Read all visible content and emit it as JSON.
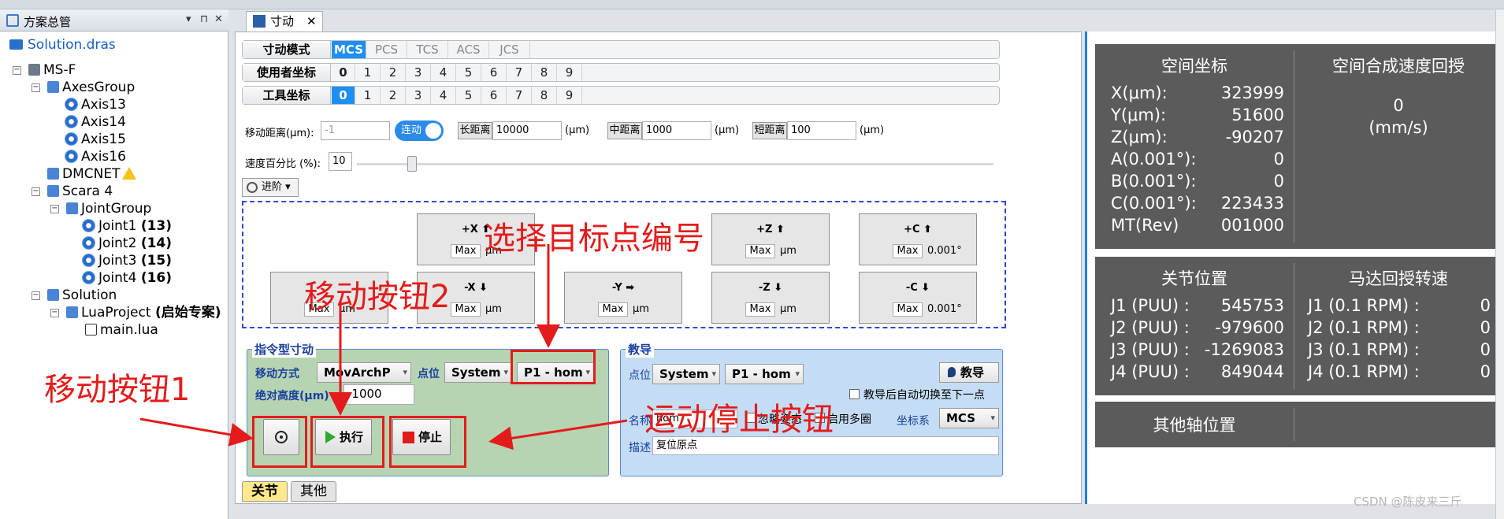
{
  "left_panel": {
    "title": "方案总管",
    "header_buttons": [
      "▾",
      "⊓",
      "✕"
    ],
    "tree": [
      {
        "label": "Solution.dras",
        "bold": ""
      },
      {
        "label": "MS-F",
        "bold": ""
      },
      {
        "label": "AxesGroup",
        "bold": ""
      },
      {
        "label": "Axis13",
        "bold": ""
      },
      {
        "label": "Axis14",
        "bold": ""
      },
      {
        "label": "Axis15",
        "bold": ""
      },
      {
        "label": "Axis16",
        "bold": ""
      },
      {
        "label": "DMCNET",
        "bold": ""
      },
      {
        "label": "Scara 4",
        "bold": ""
      },
      {
        "label": "JointGroup",
        "bold": ""
      },
      {
        "label": "Joint1 ",
        "bold": "(13)"
      },
      {
        "label": "Joint2 ",
        "bold": "(14)"
      },
      {
        "label": "Joint3 ",
        "bold": "(15)"
      },
      {
        "label": "Joint4 ",
        "bold": "(16)"
      },
      {
        "label": "Solution",
        "bold": ""
      },
      {
        "label": "LuaProject ",
        "bold": "(启始专案)"
      },
      {
        "label": "main.lua",
        "bold": ""
      }
    ]
  },
  "doc_tab": {
    "label": "寸动",
    "close": "✕"
  },
  "modes": {
    "jog_mode_label": "寸动模式",
    "jog_modes": [
      "MCS",
      "PCS",
      "TCS",
      "ACS",
      "JCS"
    ],
    "user_coord_label": "使用者坐标",
    "tool_coord_label": "工具坐标",
    "indices": [
      "0",
      "1",
      "2",
      "3",
      "4",
      "5",
      "6",
      "7",
      "8",
      "9"
    ]
  },
  "distance": {
    "label": "移动距离(μm):",
    "value": "-1",
    "toggle": "连动",
    "long_label": "长距离",
    "long_value": "10000",
    "mid_label": "中距离",
    "mid_value": "1000",
    "short_label": "短距离",
    "short_value": "100",
    "unit": "(μm)"
  },
  "speed": {
    "label": "速度百分比 (%):",
    "value": "10",
    "fraction": 0.08
  },
  "advanced_label": "进阶",
  "jog_buttons": {
    "px": "+X",
    "pz": "+Z",
    "pc": "+C",
    "nx": "-X",
    "ny": "-Y",
    "nz": "-Z",
    "nc": "-C",
    "max": "Max",
    "um": "μm",
    "deg": "0.001°"
  },
  "command_jog": {
    "title": "指令型寸动",
    "move_mode_label": "移动方式",
    "move_mode_value": "MovArchP",
    "point_label": "点位",
    "point_system": "System",
    "point_value": "P1 - hom",
    "abs_height_label": "绝对高度(μm)",
    "abs_height_value": "-1000",
    "exec_label": "执行",
    "stop_label": "停止"
  },
  "teach": {
    "title": "教导",
    "point_label": "点位",
    "system": "System",
    "point_value": "P1 - hom",
    "teach_button": "教导",
    "auto_switch": "教导后自动切换至下一点",
    "name_label": "名称",
    "name_value": "hom",
    "ignore_pose": "忽略姿态",
    "multi_turn": "启用多圈",
    "coord_label": "坐标系",
    "coord_value": "MCS",
    "desc_label": "描述",
    "desc_value": "复位原点"
  },
  "bottom_tabs": [
    "关节",
    "其他"
  ],
  "annotations": {
    "select_target": "选择目标点编号",
    "move_btn2": "移动按钮2",
    "move_btn1": "移动按钮1",
    "stop_btn": "运动停止按钮"
  },
  "space_coords": {
    "title": "空间坐标",
    "speed_title": "空间合成速度回授",
    "speed_value": "0",
    "speed_unit": "(mm/s)",
    "rows": [
      {
        "label": "X(μm):",
        "value": "323999"
      },
      {
        "label": "Y(μm):",
        "value": "51600"
      },
      {
        "label": "Z(μm):",
        "value": "-90207"
      },
      {
        "label": "A(0.001°):",
        "value": "0"
      },
      {
        "label": "B(0.001°):",
        "value": "0"
      },
      {
        "label": "C(0.001°):",
        "value": "223433"
      },
      {
        "label": "MT(Rev)",
        "value": "001000"
      }
    ]
  },
  "joint_pos": {
    "title": "关节位置",
    "rpm_title": "马达回授转速",
    "rows": [
      {
        "label": "J1 (PUU) :",
        "value": "545753",
        "rlabel": "J1 (0.1 RPM) :",
        "rvalue": "0"
      },
      {
        "label": "J2 (PUU) :",
        "value": "-979600",
        "rlabel": "J2 (0.1 RPM) :",
        "rvalue": "0"
      },
      {
        "label": "J3 (PUU) :",
        "value": "-1269083",
        "rlabel": "J3 (0.1 RPM) :",
        "rvalue": "0"
      },
      {
        "label": "J4 (PUU) :",
        "value": "849044",
        "rlabel": "J4 (0.1 RPM) :",
        "rvalue": "0"
      }
    ]
  },
  "other_axes": {
    "title": "其他轴位置"
  },
  "watermark": "CSDN @陈皮来三斤"
}
